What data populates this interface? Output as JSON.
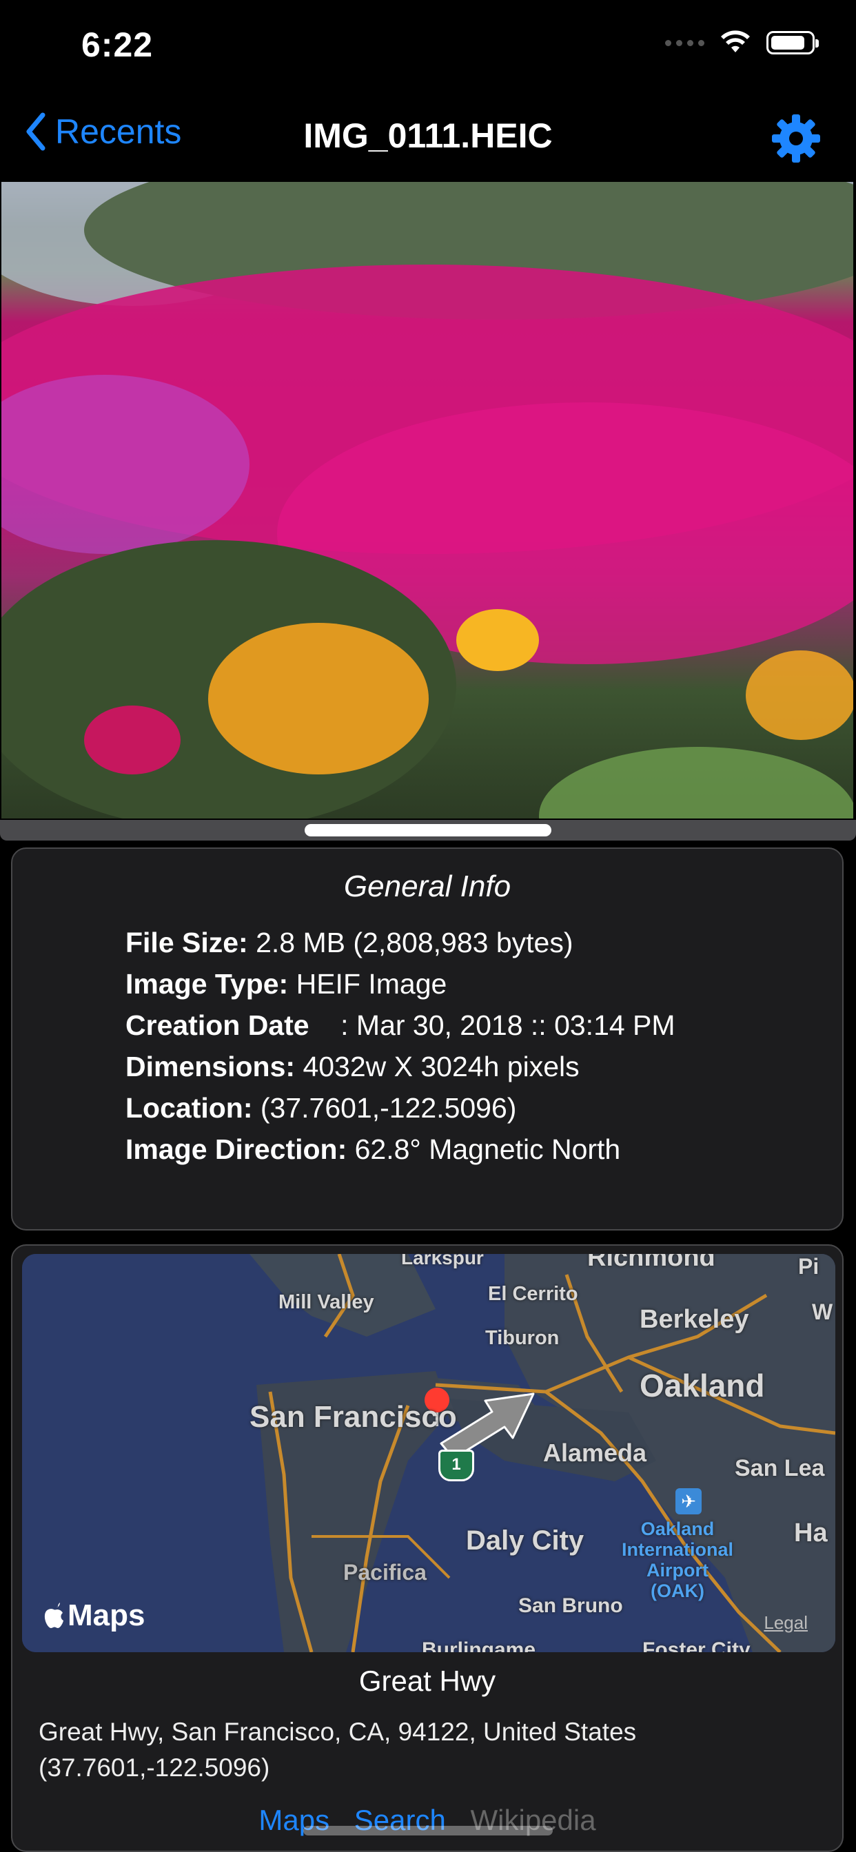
{
  "status_bar": {
    "time": "6:22",
    "battery_level": 0.85
  },
  "nav": {
    "back_label": "Recents",
    "title": "IMG_0111.HEIC",
    "accent": "#1e86ff"
  },
  "photo": {
    "subject": "flower-photo"
  },
  "general_info": {
    "title": "General Info",
    "rows": [
      {
        "label": "File Size:",
        "value": " 2.8 MB (2,808,983 bytes)"
      },
      {
        "label": "Image Type:",
        "value": " HEIF Image"
      },
      {
        "label": "Creation Date",
        "value": "    : Mar 30, 2018 :: 03:14 PM"
      },
      {
        "label": "Dimensions:",
        "value": " 4032w X 3024h pixels"
      },
      {
        "label": "Location:",
        "value": " (37.7601,-122.5096)"
      },
      {
        "label": "Image Direction:",
        "value": " 62.8° Magnetic North"
      }
    ]
  },
  "map": {
    "labels": {
      "larkspur": "Larkspur",
      "richmond": "Richmond",
      "mill_valley": "Mill Valley",
      "el_cerrito": "El Cerrito",
      "berkeley": "Berkeley",
      "tiburon": "Tiburon",
      "oakland": "Oakland",
      "san_francisco": "San Francisco",
      "alameda": "Alameda",
      "san_leandro": "San Lea",
      "daly_city": "Daly City",
      "airport": "Oakland\nInternational\nAirport\n(OAK)",
      "pacifica": "Pacifica",
      "san_bruno": "San Bruno",
      "ha": "Ha",
      "w": "W",
      "p": "Pi",
      "burlingame": "Burlingame",
      "foster_city": "Foster City",
      "route": "1"
    },
    "maps_badge": "Maps",
    "legal": "Legal"
  },
  "place": {
    "name": "Great Hwy",
    "address": "Great Hwy, San Francisco, CA, 94122, United States",
    "coords": "(37.7601,-122.5096)"
  },
  "links": {
    "maps": "Maps",
    "search": "Search",
    "wikipedia": "Wikipedia"
  }
}
